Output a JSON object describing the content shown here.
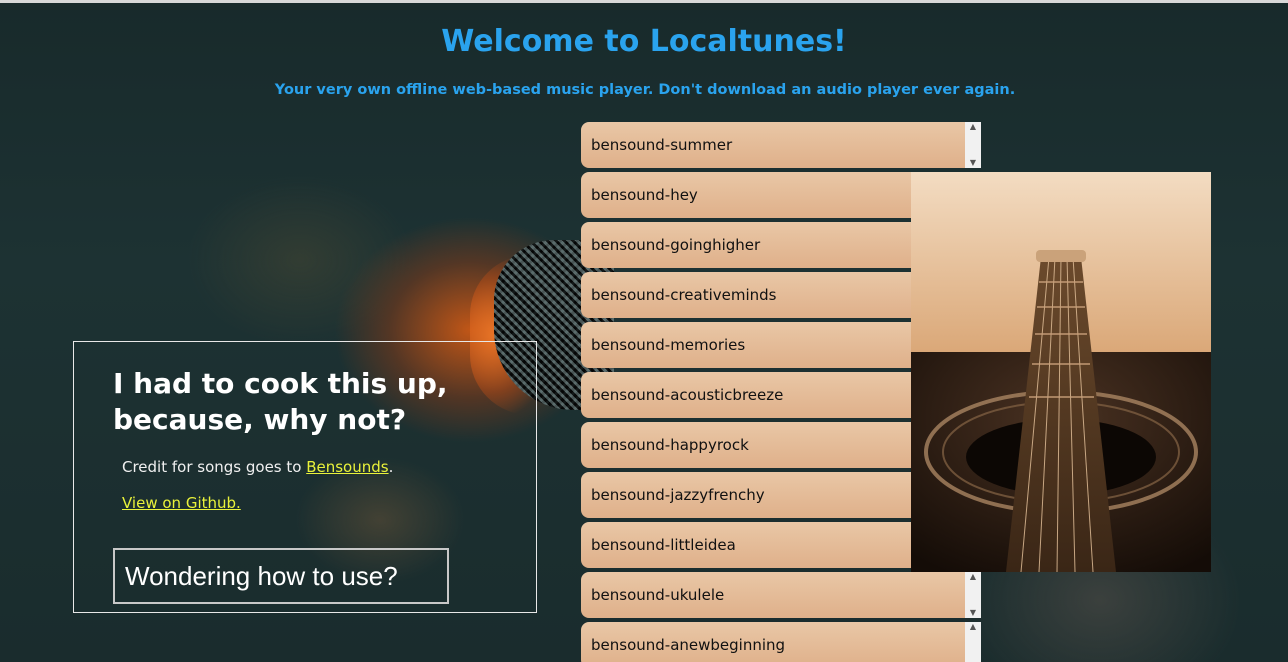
{
  "header": {
    "title": "Welcome to Localtunes!",
    "subtitle": "Your very own offline web-based music player. Don't download an audio player ever again."
  },
  "info": {
    "heading": "I had to cook this up, because, why not?",
    "credit_prefix": "Credit for songs goes to ",
    "credit_link": "Bensounds",
    "credit_suffix": ".",
    "github_link": "View on Github.",
    "help_button": "Wondering how to use?"
  },
  "playlist": {
    "songs": [
      "bensound-summer",
      "bensound-hey",
      "bensound-goinghigher",
      "bensound-creativeminds",
      "bensound-memories",
      "bensound-acousticbreeze",
      "bensound-happyrock",
      "bensound-jazzyfrenchy",
      "bensound-littleidea",
      "bensound-ukulele",
      "bensound-anewbeginning"
    ]
  },
  "colors": {
    "accent": "#2aa3ee",
    "link": "#e9f23a",
    "song_bg": "#e2b994"
  }
}
